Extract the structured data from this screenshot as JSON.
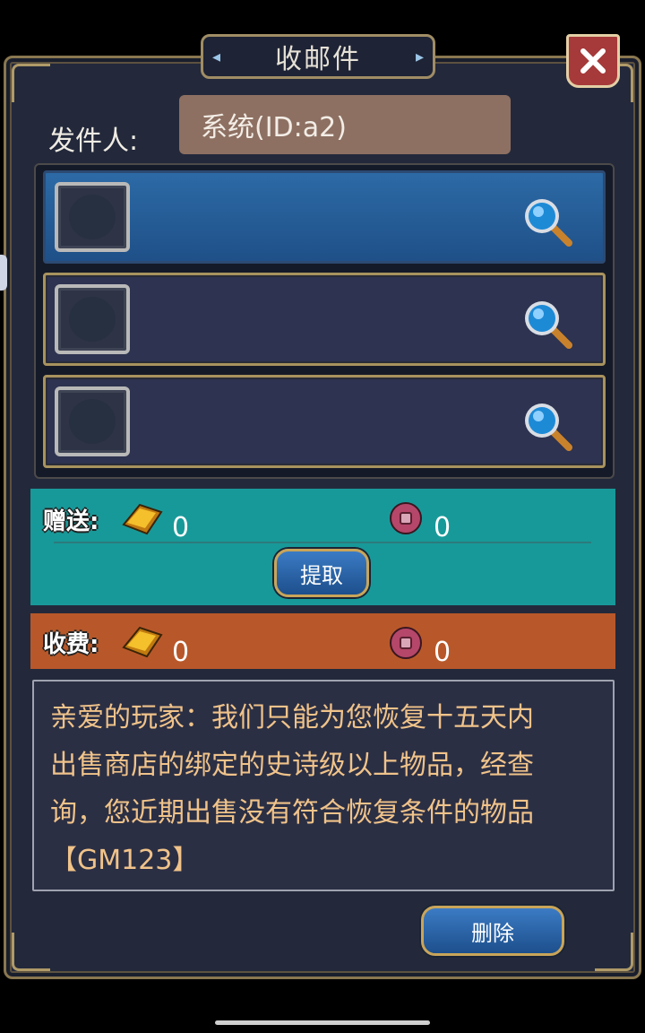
{
  "title": "收邮件",
  "sender": {
    "label": "发件人:",
    "value": "系统(ID:a2)"
  },
  "items": [
    {
      "state": "selected",
      "icon": "magnifier-icon"
    },
    {
      "state": "normal",
      "icon": "magnifier-icon"
    },
    {
      "state": "normal",
      "icon": "magnifier-icon"
    }
  ],
  "gift": {
    "label": "赠送:",
    "gold_amount": "0",
    "coin_amount": "0",
    "claim_label": "提取"
  },
  "fee": {
    "label": "收费:",
    "gold_amount": "0",
    "coin_amount": "0"
  },
  "message": "亲爱的玩家：我们只能为您恢复十五天内出售商店的绑定的史诗级以上物品，经查询，您近期出售没有符合恢复条件的物品【GM123】",
  "delete_label": "删除",
  "colors": {
    "gift_bar": "#189999",
    "fee_bar": "#b8582a",
    "message_text": "#f0c38a",
    "selected_row": "#2c6aa6"
  }
}
